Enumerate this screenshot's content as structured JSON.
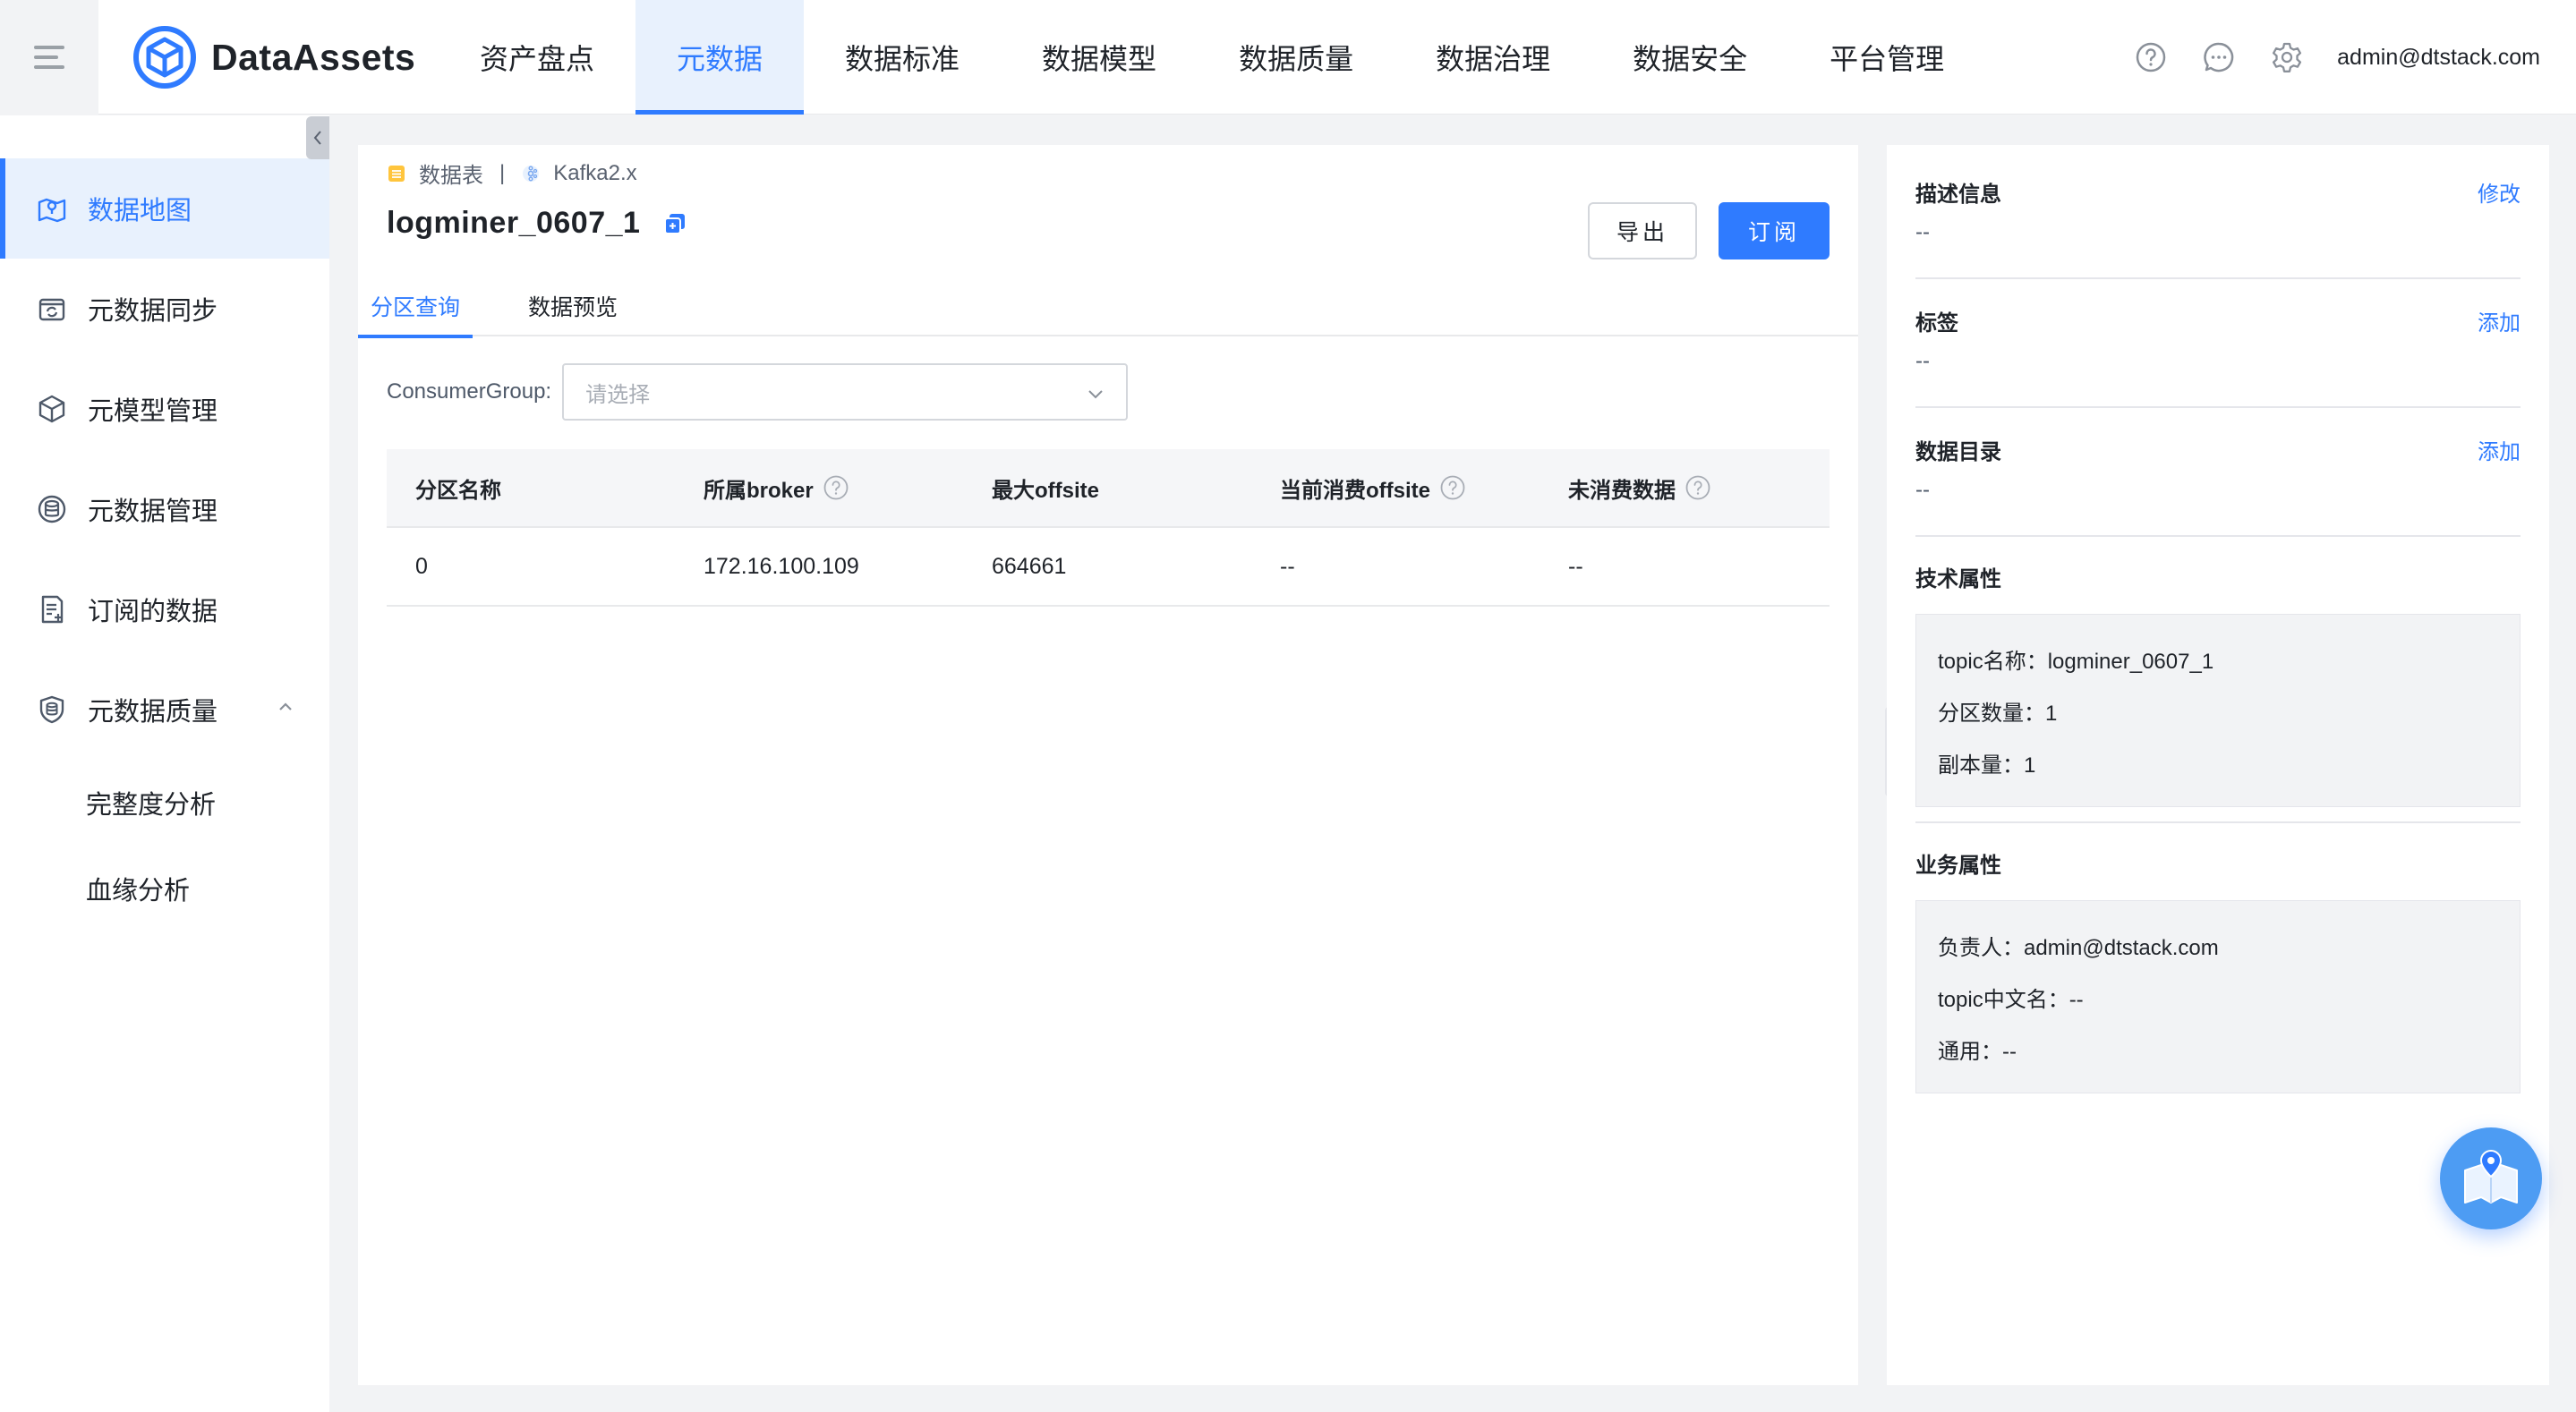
{
  "brand": {
    "name": "DataAssets"
  },
  "nav": [
    {
      "label": "资产盘点"
    },
    {
      "label": "元数据",
      "active": true
    },
    {
      "label": "数据标准"
    },
    {
      "label": "数据模型"
    },
    {
      "label": "数据质量"
    },
    {
      "label": "数据治理"
    },
    {
      "label": "数据安全"
    },
    {
      "label": "平台管理"
    }
  ],
  "header": {
    "icons": [
      "help-circle-icon",
      "message-icon",
      "gear-icon"
    ],
    "user": "admin@dtstack.com"
  },
  "sidebar": {
    "items": [
      {
        "label": "数据地图",
        "icon": "map-icon",
        "active": true
      },
      {
        "label": "元数据同步",
        "icon": "sync-icon"
      },
      {
        "label": "元模型管理",
        "icon": "cube-icon"
      },
      {
        "label": "元数据管理",
        "icon": "database-icon"
      },
      {
        "label": "订阅的数据",
        "icon": "document-icon"
      },
      {
        "label": "元数据质量",
        "icon": "db-shield-icon",
        "expanded": true
      }
    ],
    "subitems": [
      {
        "label": "完整度分析"
      },
      {
        "label": "血缘分析"
      }
    ]
  },
  "breadcrumb": {
    "type": "数据表",
    "source": "Kafka2.x"
  },
  "page": {
    "title": "logminer_0607_1"
  },
  "buttons": {
    "export": "导出",
    "subscribe": "订阅"
  },
  "tabs": [
    {
      "label": "分区查询",
      "active": true
    },
    {
      "label": "数据预览"
    }
  ],
  "filter": {
    "label": "ConsumerGroup:",
    "placeholder": "请选择"
  },
  "table": {
    "columns": [
      {
        "label": "分区名称",
        "help": false
      },
      {
        "label": "所属broker",
        "help": true
      },
      {
        "label": "最大offsite",
        "help": false
      },
      {
        "label": "当前消费offsite",
        "help": true
      },
      {
        "label": "未消费数据",
        "help": true
      }
    ],
    "rows": [
      [
        "0",
        "172.16.100.109",
        "664661",
        "--",
        "--"
      ]
    ]
  },
  "detail": {
    "description": {
      "title": "描述信息",
      "action": "修改",
      "value": "--"
    },
    "tags": {
      "title": "标签",
      "action": "添加",
      "value": "--"
    },
    "catalog": {
      "title": "数据目录",
      "action": "添加",
      "value": "--"
    },
    "tech": {
      "title": "技术属性",
      "lines": [
        "topic名称：logminer_0607_1",
        "分区数量：1",
        "副本量：1"
      ]
    },
    "biz": {
      "title": "业务属性",
      "lines": [
        "负责人：admin@dtstack.com",
        "topic中文名：--",
        "通用：--"
      ]
    }
  },
  "colors": {
    "accent": "#2f7bff",
    "accent_bg": "#e8f1fd",
    "page_bg": "#f2f3f5"
  }
}
